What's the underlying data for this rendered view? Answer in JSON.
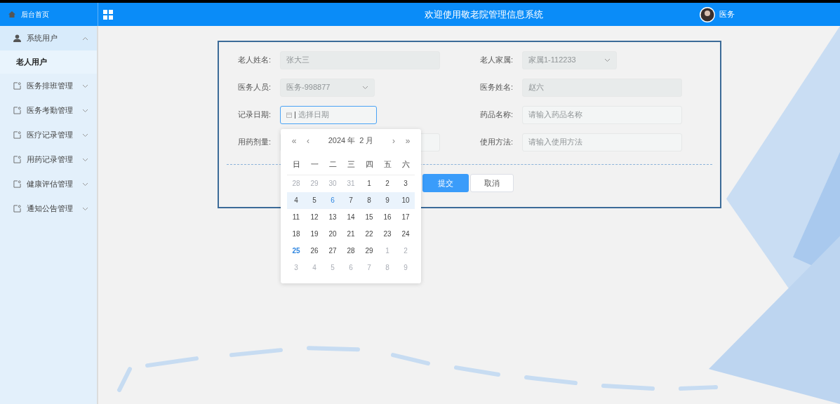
{
  "header": {
    "home": "后台首页",
    "title": "欢迎使用敬老院管理信息系统",
    "user": "医务"
  },
  "sidebar": {
    "items": [
      {
        "label": "系统用户",
        "expanded": true,
        "children": [
          {
            "label": "老人用户",
            "selected": true
          }
        ]
      },
      {
        "label": "医务排班管理",
        "expanded": false
      },
      {
        "label": "医务考勤管理",
        "expanded": false
      },
      {
        "label": "医疗记录管理",
        "expanded": false
      },
      {
        "label": "用药记录管理",
        "expanded": false
      },
      {
        "label": "健康评估管理",
        "expanded": false
      },
      {
        "label": "通知公告管理",
        "expanded": false
      }
    ]
  },
  "form": {
    "fields": [
      {
        "label": "老人姓名:",
        "kind": "input",
        "value": "张大三",
        "disabled": true,
        "focused": false
      },
      {
        "label": "老人家属:",
        "kind": "select",
        "value": "家属1-112233",
        "disabled": true,
        "focused": false
      },
      {
        "label": "医务人员:",
        "kind": "select",
        "value": "医务-998877",
        "disabled": true,
        "focused": false
      },
      {
        "label": "医务姓名:",
        "kind": "input",
        "value": "赵六",
        "disabled": true,
        "focused": false
      },
      {
        "label": "记录日期:",
        "kind": "date",
        "placeholder": "选择日期",
        "disabled": false,
        "focused": true
      },
      {
        "label": "药品名称:",
        "kind": "input",
        "placeholder": "请输入药品名称",
        "disabled": false,
        "focused": false
      },
      {
        "label": "用药剂量:",
        "kind": "input",
        "focused": false
      },
      {
        "label": "使用方法:",
        "kind": "input",
        "placeholder": "请输入使用方法",
        "disabled": false,
        "focused": false
      }
    ],
    "buttons": [
      {
        "label": "提交",
        "kind": "primary"
      },
      {
        "label": "取消",
        "kind": "default"
      }
    ]
  },
  "calendar": {
    "prev_year": "«",
    "prev_month": "‹",
    "year": "2024 年",
    "month": "2 月",
    "next_month": "›",
    "next_year": "»",
    "weekdays": [
      "日",
      "一",
      "二",
      "三",
      "四",
      "五",
      "六"
    ],
    "weeks": [
      {
        "hovered": false,
        "days": [
          {
            "label": "28",
            "kind": "other"
          },
          {
            "label": "29",
            "kind": "other"
          },
          {
            "label": "30",
            "kind": "other"
          },
          {
            "label": "31",
            "kind": "other"
          },
          {
            "label": "1",
            "kind": "normal"
          },
          {
            "label": "2",
            "kind": "normal"
          },
          {
            "label": "3",
            "kind": "normal"
          }
        ]
      },
      {
        "hovered": true,
        "days": [
          {
            "label": "4",
            "kind": "normal"
          },
          {
            "label": "5",
            "kind": "normal"
          },
          {
            "label": "6",
            "kind": "hovered"
          },
          {
            "label": "7",
            "kind": "normal"
          },
          {
            "label": "8",
            "kind": "normal"
          },
          {
            "label": "9",
            "kind": "normal"
          },
          {
            "label": "10",
            "kind": "normal"
          }
        ]
      },
      {
        "hovered": false,
        "days": [
          {
            "label": "11",
            "kind": "normal"
          },
          {
            "label": "12",
            "kind": "normal"
          },
          {
            "label": "13",
            "kind": "normal"
          },
          {
            "label": "14",
            "kind": "normal"
          },
          {
            "label": "15",
            "kind": "normal"
          },
          {
            "label": "16",
            "kind": "normal"
          },
          {
            "label": "17",
            "kind": "normal"
          }
        ]
      },
      {
        "hovered": false,
        "days": [
          {
            "label": "18",
            "kind": "normal"
          },
          {
            "label": "19",
            "kind": "normal"
          },
          {
            "label": "20",
            "kind": "normal"
          },
          {
            "label": "21",
            "kind": "normal"
          },
          {
            "label": "22",
            "kind": "normal"
          },
          {
            "label": "23",
            "kind": "normal"
          },
          {
            "label": "24",
            "kind": "normal"
          }
        ]
      },
      {
        "hovered": false,
        "days": [
          {
            "label": "25",
            "kind": "today"
          },
          {
            "label": "26",
            "kind": "normal"
          },
          {
            "label": "27",
            "kind": "normal"
          },
          {
            "label": "28",
            "kind": "normal"
          },
          {
            "label": "29",
            "kind": "normal"
          },
          {
            "label": "1",
            "kind": "other"
          },
          {
            "label": "2",
            "kind": "other"
          }
        ]
      },
      {
        "hovered": false,
        "days": [
          {
            "label": "3",
            "kind": "other"
          },
          {
            "label": "4",
            "kind": "other"
          },
          {
            "label": "5",
            "kind": "other"
          },
          {
            "label": "6",
            "kind": "other"
          },
          {
            "label": "7",
            "kind": "other"
          },
          {
            "label": "8",
            "kind": "other"
          },
          {
            "label": "9",
            "kind": "other"
          }
        ]
      }
    ]
  }
}
